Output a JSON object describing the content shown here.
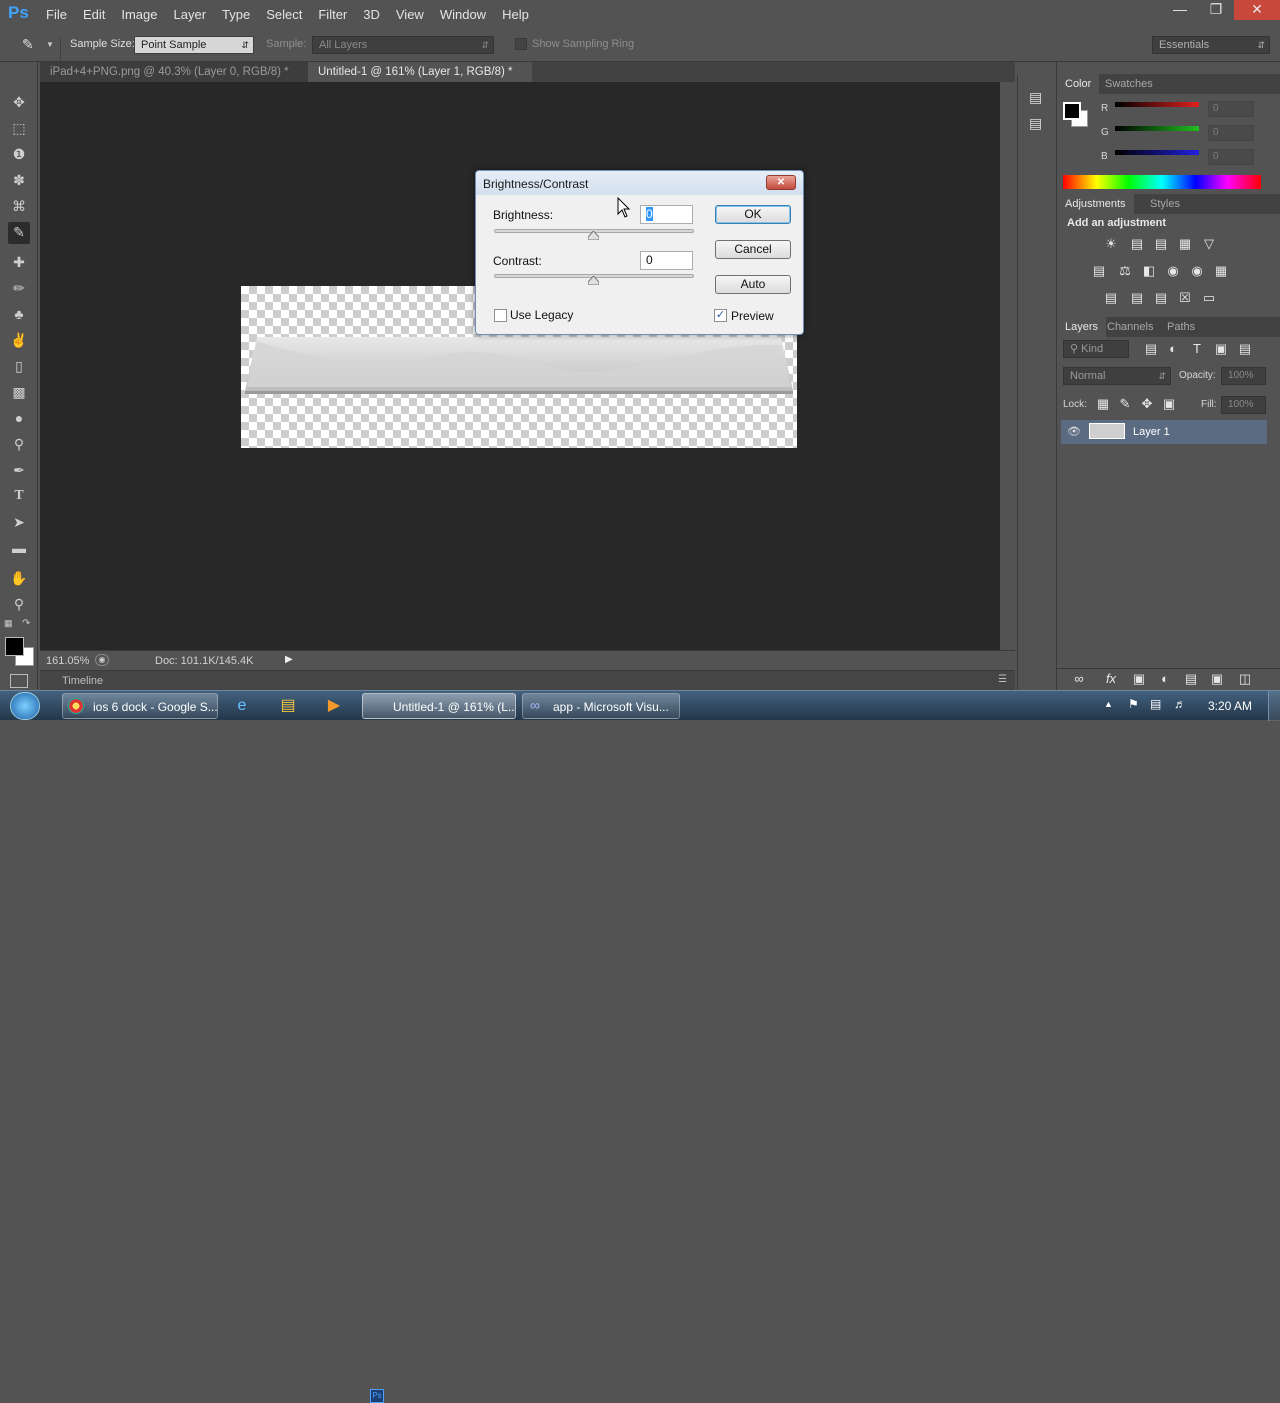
{
  "app": {
    "logo": "Ps",
    "menus": [
      "File",
      "Edit",
      "Image",
      "Layer",
      "Type",
      "Select",
      "Filter",
      "3D",
      "View",
      "Window",
      "Help"
    ]
  },
  "options": {
    "sample_size_label": "Sample Size:",
    "sample_size_value": "Point Sample",
    "sample_label": "Sample:",
    "sample_value": "All Layers",
    "show_ring_label": "Show Sampling Ring",
    "workspace": "Essentials"
  },
  "tabs": [
    {
      "label": "iPad+4+PNG.png @ 40.3% (Layer 0, RGB/8) *",
      "close": "×"
    },
    {
      "label": "Untitled-1 @ 161% (Layer 1, RGB/8) *",
      "close": "×"
    }
  ],
  "status": {
    "zoom": "161.05%",
    "doc": "Doc: 101.1K/145.4K"
  },
  "timeline": {
    "label": "Timeline"
  },
  "dialog": {
    "title": "Brightness/Contrast",
    "brightness_label": "Brightness:",
    "brightness_value": "0",
    "contrast_label": "Contrast:",
    "contrast_value": "0",
    "ok": "OK",
    "cancel": "Cancel",
    "auto": "Auto",
    "legacy_label": "Use Legacy",
    "preview_label": "Preview",
    "legacy_checked": false,
    "preview_checked": true
  },
  "color_panel": {
    "tabs": [
      "Color",
      "Swatches"
    ],
    "channels": [
      {
        "name": "R",
        "color": "#e02020"
      },
      {
        "name": "G",
        "color": "#20c020"
      },
      {
        "name": "B",
        "color": "#2020e0"
      }
    ]
  },
  "adjustments": {
    "tabs": [
      "Adjustments",
      "Styles"
    ],
    "heading": "Add an adjustment"
  },
  "layers": {
    "tabs": [
      "Layers",
      "Channels",
      "Paths"
    ],
    "kind": "Kind",
    "blend_mode": "Normal",
    "opacity_label": "Opacity:",
    "opacity_value": "100%",
    "lock_label": "Lock:",
    "fill_label": "Fill:",
    "fill_value": "100%",
    "items": [
      {
        "name": "Layer 1",
        "visible": true,
        "selected": true
      }
    ]
  },
  "taskbar": {
    "tasks": [
      {
        "label": "ios 6 dock - Google S..."
      },
      {
        "label": "Untitled-1 @ 161% (L..."
      },
      {
        "label": "app - Microsoft Visu..."
      }
    ],
    "clock": "3:20 AM"
  }
}
